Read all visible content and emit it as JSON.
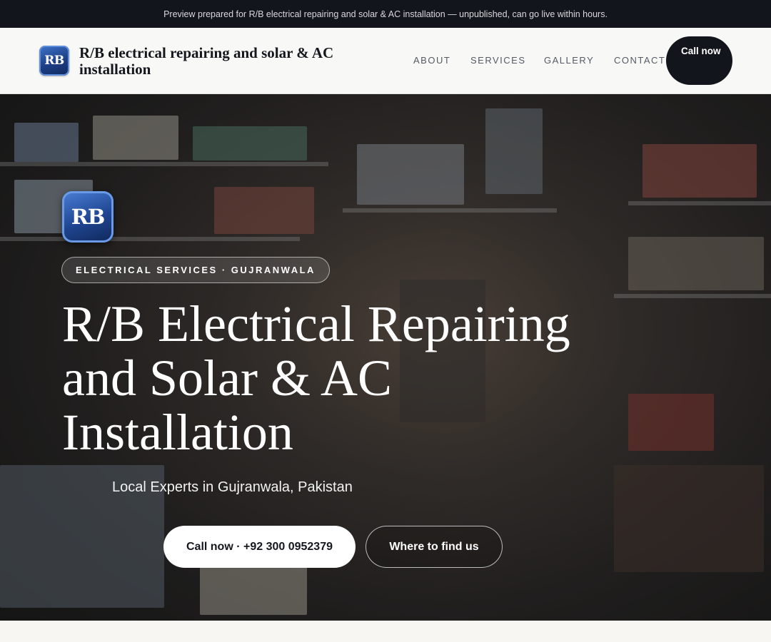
{
  "preview_bar": {
    "text": "Preview prepared for R/B electrical repairing and solar & AC installation — unpublished, can go live within hours."
  },
  "header": {
    "logo_text": "RB",
    "brand_name": "R/B electrical repairing and solar & AC installation",
    "nav": [
      "ABOUT",
      "SERVICES",
      "GALLERY",
      "CONTACT"
    ],
    "call_button": "Call now"
  },
  "hero": {
    "logo_text": "RB",
    "badge": "ELECTRICAL SERVICES · GUJRANWALA",
    "title": "R/B Electrical Repairing and Solar & AC Installation",
    "subtitle": "Local Experts in Gujranwala, Pakistan",
    "cta_primary": "Call now · +92 300 0952379",
    "cta_secondary": "Where to find us"
  },
  "colors": {
    "dark": "#12151b",
    "logo_blue": "#1d3f86",
    "header_bg": "#f8f8f7"
  }
}
